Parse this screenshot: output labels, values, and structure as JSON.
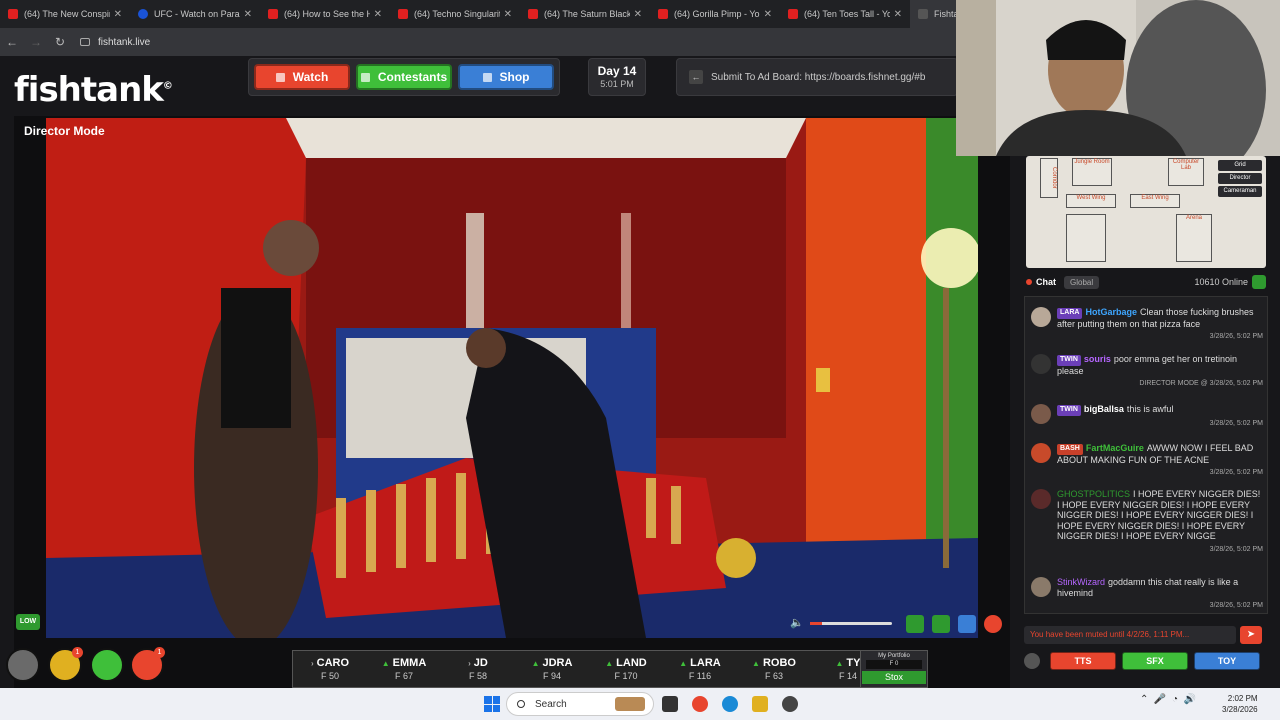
{
  "browser": {
    "tabs": [
      {
        "title": "(64) The New Conspira",
        "fav": "youtube"
      },
      {
        "title": "UFC - Watch on Paramo",
        "fav": "paramount"
      },
      {
        "title": "(64) How to See the Ha",
        "fav": "youtube"
      },
      {
        "title": "(64) Techno Singularity",
        "fav": "youtube"
      },
      {
        "title": "(64) The Saturn Black C",
        "fav": "youtube"
      },
      {
        "title": "(64) Gorilla Pimp - You",
        "fav": "youtube"
      },
      {
        "title": "(64) Ten Toes Tall - You",
        "fav": "youtube"
      },
      {
        "title": "Fishta",
        "fav": "fishtank"
      }
    ],
    "url": "fishtank.live"
  },
  "site": {
    "logo": "fishtank",
    "logo_mark": "©",
    "nav": {
      "watch": "Watch",
      "contestants": "Contestants",
      "shop": "Shop"
    },
    "day": {
      "label": "Day 14",
      "time": "5:01 PM"
    },
    "ad_board": "Submit To Ad Board: https://boards.fishnet.gg/#b"
  },
  "video": {
    "mode_label": "Director Mode",
    "quality": "LOW",
    "volume_fraction": 0.15
  },
  "minimap": {
    "rooms": [
      "Jungle Room",
      "Computer Lab",
      "West Wing",
      "East Wing",
      "Arena",
      "Corridor"
    ],
    "buttons": [
      "Grid",
      "Director",
      "Cameraman"
    ]
  },
  "chat": {
    "tab": "Chat",
    "scope": "Global",
    "online": "10610 Online",
    "messages": [
      {
        "badge": "LARA",
        "user": "HotGarbage",
        "user_color": "#3ea6ff",
        "text": "Clean those fucking brushes after putting them on that pizza face",
        "ts": "3/28/26, 5:02 PM"
      },
      {
        "badge": "TWIN",
        "user": "souris",
        "user_color": "#b566ff",
        "text": "poor emma get her on tretinoin please",
        "ts": "DIRECTOR MODE @ 3/28/26, 5:02 PM"
      },
      {
        "badge": "TWIN",
        "user": "bigBallsa",
        "user_color": "#ffffff",
        "text": "this is awful",
        "ts": "3/28/26, 5:02 PM"
      },
      {
        "badge": "BASH",
        "user": "FartMacGuire",
        "user_color": "#3fbf3a",
        "text": "AWWW NOW I FEEL BAD ABOUT MAKING FUN OF THE ACNE",
        "ts": "3/28/26, 5:02 PM"
      },
      {
        "badge": "",
        "user": "GHOSTPOLITICS",
        "user_color": "#2f9a2f",
        "text": "I HOPE EVERY NIGGER DIES! I HOPE EVERY NIGGER DIES! I HOPE EVERY NIGGER DIES! I HOPE EVERY NIGGER DIES! I HOPE EVERY NIGGER DIES! I HOPE EVERY NIGGER DIES! I HOPE EVERY NIGGE",
        "ts": "3/28/26, 5:02 PM"
      },
      {
        "badge": "",
        "user": "StinkWizard",
        "user_color": "#b566ff",
        "text": "goddamn this chat really is like a hivemind",
        "ts": "3/28/26, 5:02 PM"
      }
    ],
    "muted_notice": "You have been muted until 4/2/26, 1:11 PM...",
    "tools": {
      "tts": "TTS",
      "sfx": "SFX",
      "toy": "TOY"
    }
  },
  "stocks": [
    {
      "name": "CARO",
      "value": "F 50",
      "trend": "neutral"
    },
    {
      "name": "EMMA",
      "value": "F 67",
      "trend": "up"
    },
    {
      "name": "JD",
      "value": "F 58",
      "trend": "neutral"
    },
    {
      "name": "JDRA",
      "value": "F 94",
      "trend": "up"
    },
    {
      "name": "LAND",
      "value": "F 170",
      "trend": "up"
    },
    {
      "name": "LARA",
      "value": "F 116",
      "trend": "up"
    },
    {
      "name": "ROBO",
      "value": "F 63",
      "trend": "up"
    },
    {
      "name": "TY",
      "value": "F 14",
      "trend": "up"
    }
  ],
  "portfolio": {
    "label": "My Portfolio",
    "value": "F 0",
    "button": "Stox"
  },
  "bottom_icons": {
    "notif_1": "1",
    "notif_2": "1"
  },
  "taskbar": {
    "search": "Search",
    "time": "2:02 PM",
    "date": "3/28/2026"
  },
  "colors": {
    "accent_red": "#e8452e",
    "accent_green": "#3fbf3a",
    "accent_blue": "#3a7fd6"
  }
}
